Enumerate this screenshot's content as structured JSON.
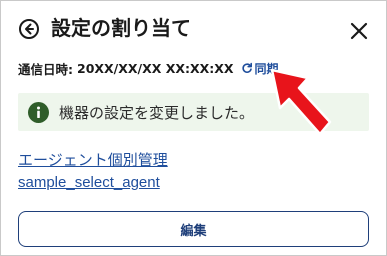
{
  "header": {
    "title": "設定の割り当て"
  },
  "sync": {
    "label": "通信日時:",
    "timestamp": "20XX/XX/XX XX:XX:XX",
    "link_label": "同期"
  },
  "alert": {
    "message": "機器の設定を変更しました。"
  },
  "links": {
    "agent_management": "エージェント個別管理",
    "agent_name": "sample_select_agent"
  },
  "actions": {
    "edit_label": "編集"
  },
  "colors": {
    "accent": "#1f4e9c",
    "success_bg": "#eef6ec",
    "success_icon": "#2f5d2a",
    "annotation_arrow": "#e8141b"
  },
  "icons": {
    "back": "circle-arrow-left-icon",
    "close": "close-icon",
    "sync": "refresh-icon",
    "alert": "info-icon"
  }
}
